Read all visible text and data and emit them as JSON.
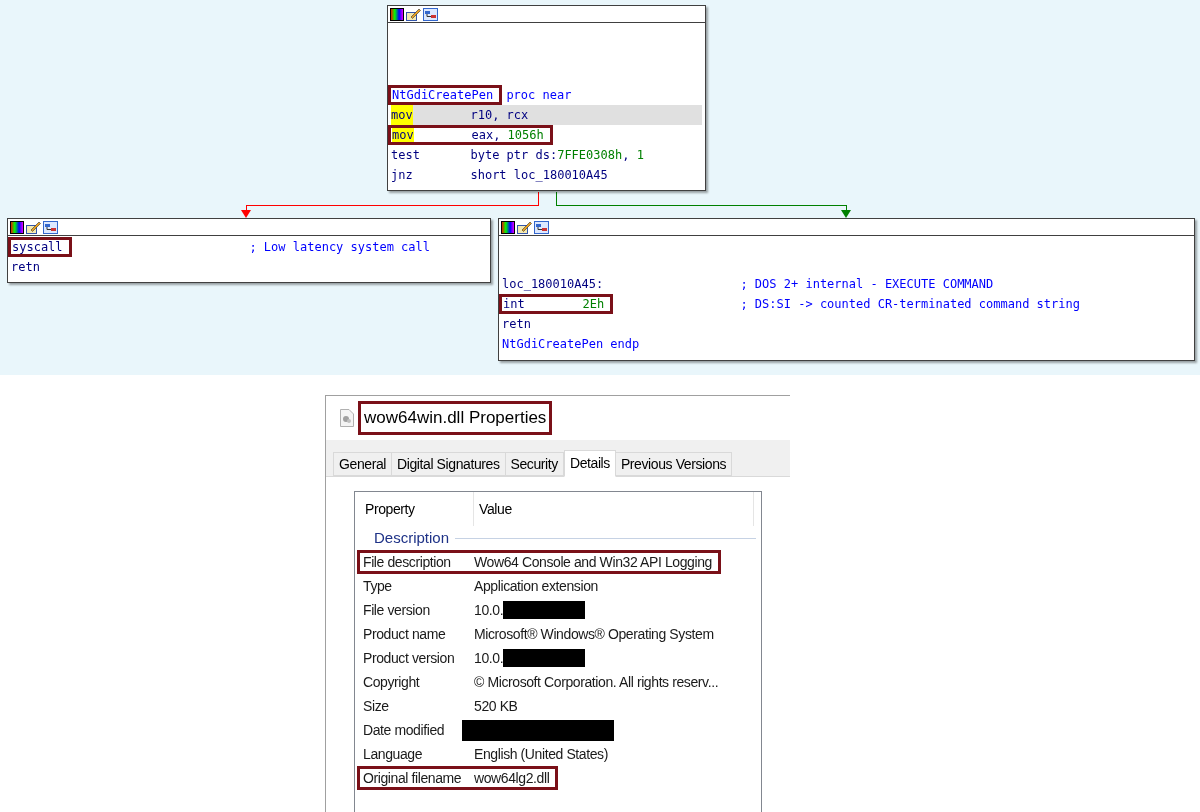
{
  "graph": {
    "nodes": [
      {
        "lines": [
          {
            "tokens": [
              {
                "text": "NtGdiCreatePen",
                "kind": "name",
                "boxed": true
              },
              {
                "text": " proc near",
                "kind": "name"
              }
            ],
            "selected": false
          },
          {
            "tokens": [
              {
                "text": "mov",
                "kind": "mnemonic",
                "highlighted": true
              },
              {
                "text": "r10, rcx",
                "kind": "text"
              }
            ],
            "selected": true
          },
          {
            "tokens": [
              {
                "text": "mov",
                "kind": "mnemonic",
                "highlighted": true,
                "boxed": true
              },
              {
                "text": "eax, ",
                "kind": "text",
                "boxed": true
              },
              {
                "text": "1056h",
                "kind": "number",
                "boxed": true
              }
            ],
            "selected": false
          },
          {
            "tokens": [
              {
                "text": "test",
                "kind": "mnemonic",
                "highlighted": false
              },
              {
                "text": "byte ptr ds:",
                "kind": "text"
              },
              {
                "text": "7FFE0308h",
                "kind": "number"
              },
              {
                "text": ", ",
                "kind": "text"
              },
              {
                "text": "1",
                "kind": "number"
              }
            ],
            "selected": false
          },
          {
            "tokens": [
              {
                "text": "jnz",
                "kind": "mnemonic",
                "highlighted": false
              },
              {
                "text": "short loc_180010A45",
                "kind": "text"
              }
            ],
            "selected": false
          }
        ]
      },
      {
        "lines": [
          {
            "tokens": [
              {
                "text": "syscall",
                "kind": "mnemonic",
                "highlighted": false,
                "boxed": true
              }
            ],
            "comment": "; Low latency system call",
            "selected": false
          },
          {
            "tokens": [
              {
                "text": "retn",
                "kind": "mnemonic",
                "highlighted": false
              }
            ],
            "selected": false
          }
        ]
      },
      {
        "lines": [
          {
            "tokens": [
              {
                "text": "loc_180010A45:",
                "kind": "text"
              }
            ],
            "comment": "; DOS 2+ internal - EXECUTE COMMAND",
            "selected": false
          },
          {
            "tokens": [
              {
                "text": "int",
                "kind": "mnemonic",
                "highlighted": false,
                "boxed": true
              },
              {
                "text": "2Eh",
                "kind": "number",
                "boxed": true
              }
            ],
            "comment": "; DS:SI -> counted CR-terminated command string",
            "selected": false
          },
          {
            "tokens": [
              {
                "text": "retn",
                "kind": "mnemonic",
                "highlighted": false
              }
            ],
            "selected": false
          },
          {
            "tokens": [
              {
                "text": "NtGdiCreatePen endp",
                "kind": "name"
              }
            ],
            "selected": false
          }
        ]
      }
    ],
    "edges": [
      {
        "color": "#ff0000"
      },
      {
        "color": "#008000"
      }
    ]
  },
  "properties_dialog": {
    "title": "wow64win.dll Properties",
    "title_highlighted": true,
    "tabs": [
      {
        "label": "General",
        "selected": false
      },
      {
        "label": "Digital Signatures",
        "selected": false
      },
      {
        "label": "Security",
        "selected": false
      },
      {
        "label": "Details",
        "selected": true
      },
      {
        "label": "Previous Versions",
        "selected": false
      }
    ],
    "columns": [
      "Property",
      "Value"
    ],
    "group": "Description",
    "rows": [
      {
        "property": "File description",
        "value": "Wow64 Console and Win32 API Logging",
        "redacted": false,
        "highlighted": true
      },
      {
        "property": "Type",
        "value": "Application extension",
        "redacted": false,
        "highlighted": false
      },
      {
        "property": "File version",
        "value": "10.0.",
        "redacted": true,
        "highlighted": false
      },
      {
        "property": "Product name",
        "value": "Microsoft® Windows® Operating System",
        "redacted": false,
        "highlighted": false
      },
      {
        "property": "Product version",
        "value": "10.0.",
        "redacted": true,
        "highlighted": false
      },
      {
        "property": "Copyright",
        "value": "© Microsoft Corporation. All rights reserv...",
        "redacted": false,
        "highlighted": false
      },
      {
        "property": "Size",
        "value": "520 KB",
        "redacted": false,
        "highlighted": false
      },
      {
        "property": "Date modified",
        "redacted": true,
        "highlighted": false
      },
      {
        "property": "Language",
        "value": "English (United States)",
        "redacted": false,
        "highlighted": false
      },
      {
        "property": "Original filename",
        "value": "wow64lg2.dll",
        "redacted": false,
        "highlighted": true
      }
    ]
  }
}
